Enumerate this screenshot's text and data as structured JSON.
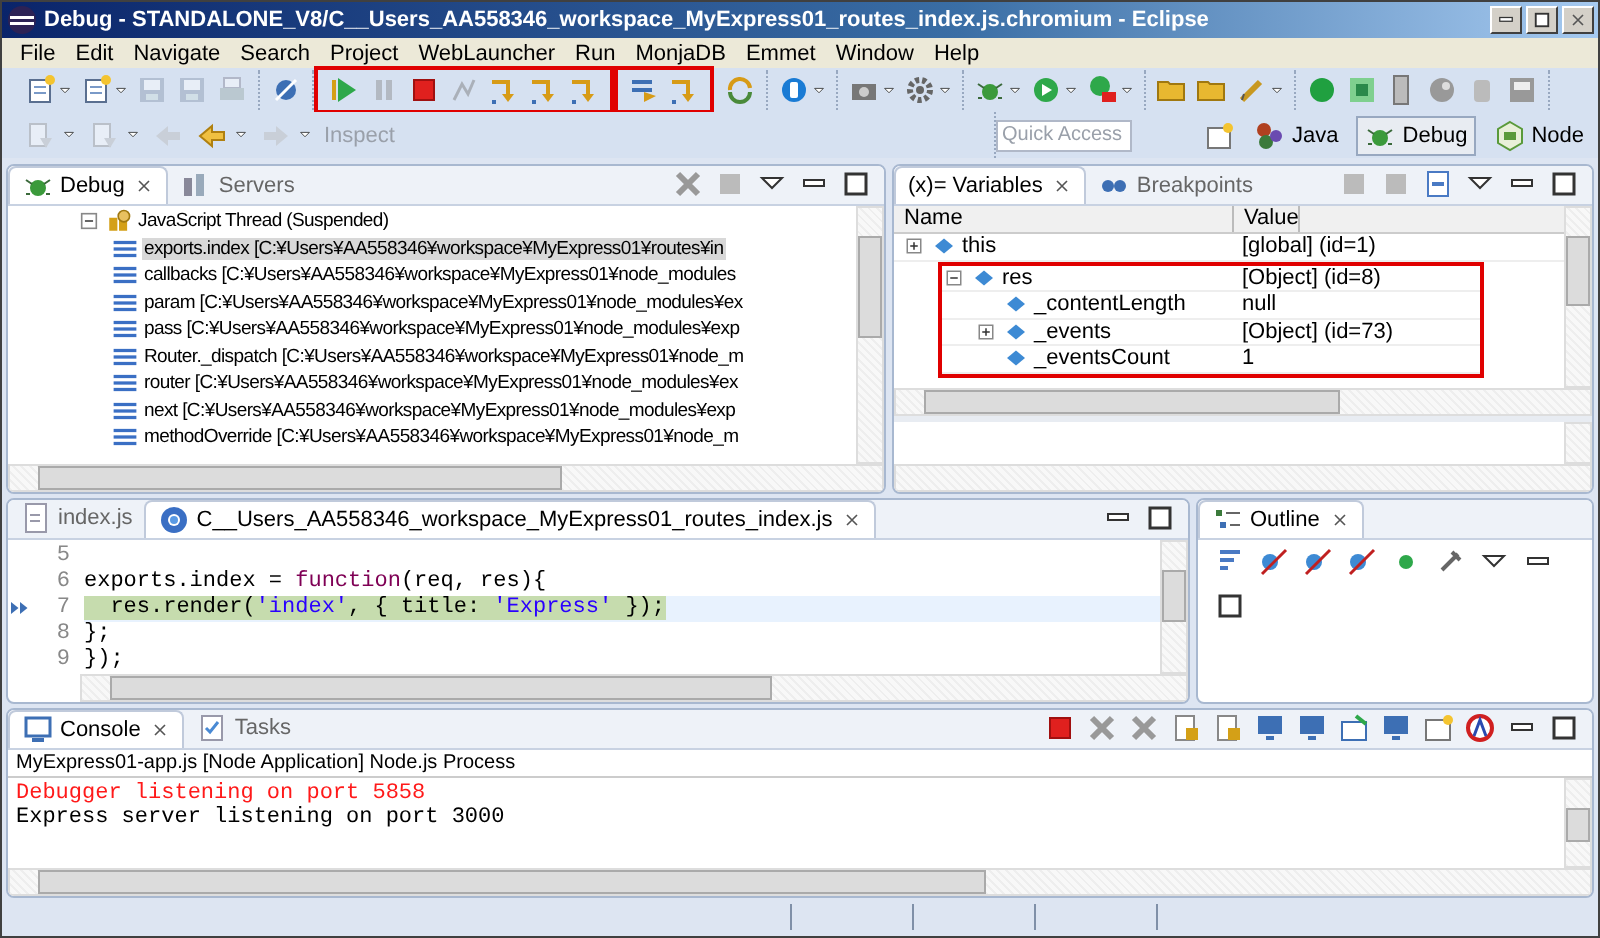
{
  "window": {
    "title": "Debug - STANDALONE_V8/C__Users_AA558346_workspace_MyExpress01_routes_index.js.chromium - Eclipse"
  },
  "menu": [
    "File",
    "Edit",
    "Navigate",
    "Search",
    "Project",
    "WebLauncher",
    "Run",
    "MonjaDB",
    "Emmet",
    "Window",
    "Help"
  ],
  "toolbar": {
    "groups": [
      {
        "items": [
          {
            "kind": "new",
            "menu": true,
            "disabled": false
          },
          {
            "kind": "new",
            "menu": true,
            "disabled": false
          },
          {
            "kind": "save",
            "disabled": true
          },
          {
            "kind": "save",
            "disabled": true
          },
          {
            "kind": "print",
            "disabled": true
          }
        ]
      },
      {
        "items": [
          {
            "kind": "skip",
            "disabled": false
          }
        ]
      },
      {
        "highlighted": true,
        "items": [
          {
            "kind": "play",
            "disabled": false
          },
          {
            "kind": "pause",
            "disabled": true
          },
          {
            "kind": "stop",
            "disabled": false
          },
          {
            "kind": "link",
            "disabled": true
          },
          {
            "kind": "step",
            "disabled": false
          },
          {
            "kind": "step",
            "disabled": false
          },
          {
            "kind": "step",
            "disabled": false
          }
        ]
      },
      {
        "highlighted": true,
        "items": [
          {
            "kind": "filter",
            "disabled": false
          },
          {
            "kind": "step",
            "disabled": false
          }
        ]
      },
      {
        "items": [
          {
            "kind": "refresh",
            "disabled": false
          }
        ]
      },
      {
        "items": [
          {
            "kind": "info",
            "menu": true,
            "disabled": false
          }
        ]
      },
      {
        "items": [
          {
            "kind": "camera",
            "menu": true,
            "disabled": false
          },
          {
            "kind": "gear",
            "menu": true,
            "disabled": false
          }
        ]
      },
      {
        "items": [
          {
            "kind": "bug",
            "menu": true,
            "disabled": false
          },
          {
            "kind": "run",
            "menu": true,
            "disabled": false
          },
          {
            "kind": "runext",
            "menu": true,
            "disabled": false
          }
        ]
      },
      {
        "items": [
          {
            "kind": "folder",
            "disabled": false
          },
          {
            "kind": "folder",
            "disabled": false
          },
          {
            "kind": "pen",
            "menu": true,
            "disabled": false
          }
        ]
      },
      {
        "items": [
          {
            "kind": "dot",
            "disabled": false
          },
          {
            "kind": "square",
            "disabled": false
          },
          {
            "kind": "device",
            "disabled": false
          },
          {
            "kind": "globe",
            "disabled": false
          },
          {
            "kind": "jar",
            "disabled": false
          },
          {
            "kind": "card",
            "disabled": false
          }
        ]
      }
    ]
  },
  "navbar": {
    "items": [
      {
        "kind": "nav",
        "menu": true,
        "disabled": true
      },
      {
        "kind": "nav",
        "menu": true,
        "disabled": true
      },
      {
        "kind": "back",
        "disabled": true
      },
      {
        "kind": "backyellow",
        "menu": true,
        "disabled": false
      },
      {
        "kind": "forward",
        "menu": true,
        "disabled": true
      }
    ],
    "inspect": "Inspect"
  },
  "quick_access": {
    "placeholder": "Quick Access"
  },
  "perspectives": [
    {
      "label": "Java",
      "selected": false,
      "kind": "java"
    },
    {
      "label": "Debug",
      "selected": true,
      "kind": "bug"
    },
    {
      "label": "Node",
      "selected": false,
      "kind": "node"
    }
  ],
  "debug_view": {
    "tabs": [
      {
        "label": "Debug",
        "selected": true
      },
      {
        "label": "Servers",
        "selected": false
      }
    ],
    "tree": [
      {
        "label": "JavaScript Thread (Suspended)",
        "expanded": true,
        "children": [
          {
            "label": "exports.index [C:¥Users¥AA558346¥workspace¥MyExpress01¥routes¥in",
            "selected": true
          },
          {
            "label": "callbacks [C:¥Users¥AA558346¥workspace¥MyExpress01¥node_modules",
            "selected": false
          },
          {
            "label": "param [C:¥Users¥AA558346¥workspace¥MyExpress01¥node_modules¥ex",
            "selected": false
          },
          {
            "label": "pass [C:¥Users¥AA558346¥workspace¥MyExpress01¥node_modules¥exp",
            "selected": false
          },
          {
            "label": "Router._dispatch [C:¥Users¥AA558346¥workspace¥MyExpress01¥node_m",
            "selected": false
          },
          {
            "label": "router [C:¥Users¥AA558346¥workspace¥MyExpress01¥node_modules¥ex",
            "selected": false
          },
          {
            "label": "next [C:¥Users¥AA558346¥workspace¥MyExpress01¥node_modules¥exp",
            "selected": false
          },
          {
            "label": "methodOverride [C:¥Users¥AA558346¥workspace¥MyExpress01¥node_m",
            "selected": false
          }
        ]
      }
    ]
  },
  "variables_view": {
    "tabs": [
      {
        "label": "(x)= Variables",
        "selected": true
      },
      {
        "label": "Breakpoints",
        "selected": false
      }
    ],
    "columns": [
      "Name",
      "Value"
    ],
    "rows": [
      {
        "name": "this",
        "value": "[global]  (id=1)",
        "expanded": false
      },
      {
        "name": "res",
        "value": "[Object]  (id=8)",
        "expanded": true,
        "highlighted": true,
        "children": [
          {
            "name": "_contentLength",
            "value": "null"
          },
          {
            "name": "_events",
            "value": "[Object]  (id=73)",
            "expanded": false
          },
          {
            "name": "_eventsCount",
            "value": "1"
          }
        ]
      }
    ]
  },
  "editor": {
    "tabs": [
      {
        "label": "index.js",
        "selected": false
      },
      {
        "label": "C__Users_AA558346_workspace_MyExpress01_routes_index.js",
        "selected": true
      }
    ],
    "lines": [
      {
        "number": "5"
      },
      {
        "number": "6",
        "tokens": [
          {
            "text": "exports.index = ",
            "kind": "plain"
          },
          {
            "text": "function",
            "kind": "keyword"
          },
          {
            "text": "(req, res){",
            "kind": "plain"
          }
        ]
      },
      {
        "number": "7",
        "current": true,
        "tokens": [
          {
            "text": "  res.render(",
            "kind": "plain"
          },
          {
            "text": "'index'",
            "kind": "string"
          },
          {
            "text": ", { title: ",
            "kind": "plain"
          },
          {
            "text": "'Express'",
            "kind": "string"
          },
          {
            "text": " });",
            "kind": "plain"
          }
        ]
      },
      {
        "number": "8",
        "tokens": [
          {
            "text": "};",
            "kind": "plain"
          }
        ]
      },
      {
        "number": "9",
        "tokens": [
          {
            "text": "});",
            "kind": "plain"
          }
        ]
      }
    ]
  },
  "outline_view": {
    "tabs": [
      {
        "label": "Outline",
        "selected": true
      }
    ]
  },
  "console_view": {
    "tabs": [
      {
        "label": "Console",
        "selected": true
      },
      {
        "label": "Tasks",
        "selected": false
      }
    ],
    "process": "MyExpress01-app.js [Node Application] Node.js Process",
    "lines": [
      {
        "text": "Debugger listening on port 5858",
        "kind": "stderr"
      },
      {
        "text": "Express server listening on port 3000",
        "kind": "stdout"
      }
    ]
  }
}
